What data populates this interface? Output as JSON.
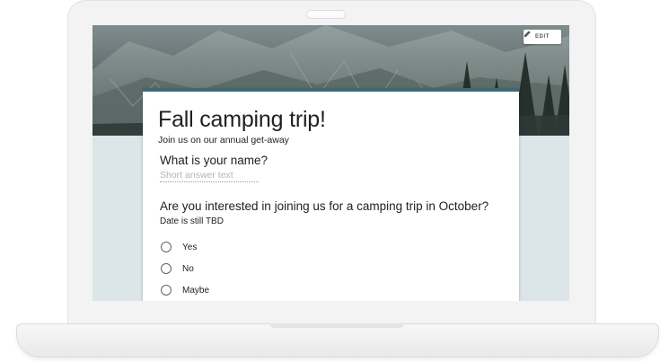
{
  "header": {
    "edit_label": "EDIT",
    "edit_icon": "pencil-icon"
  },
  "form": {
    "title": "Fall camping trip!",
    "description": "Join us on our annual get-away",
    "accent_color": "#3b6a76",
    "questions": [
      {
        "title": "What is your name?",
        "placeholder": "Short answer text"
      },
      {
        "title": "Are you interested in joining us for a camping trip in October?",
        "description": "Date is still TBD",
        "options": [
          "Yes",
          "No",
          "Maybe"
        ]
      }
    ]
  }
}
